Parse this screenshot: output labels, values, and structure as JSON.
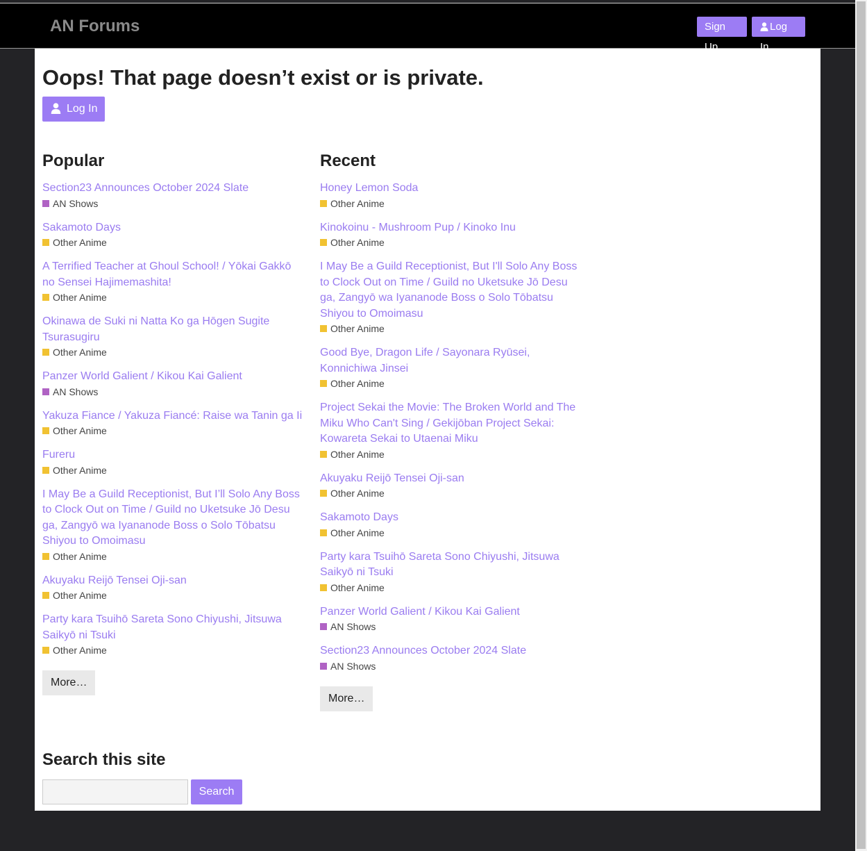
{
  "header": {
    "site_title": "AN Forums",
    "signup_label": "Sign Up",
    "login_label": "Log In"
  },
  "main": {
    "title": "Oops! That page doesn’t exist or is private.",
    "login_label": "Log In"
  },
  "colors": {
    "accent": "#9c7cf4",
    "link": "#9a7cf0",
    "category_an_shows": "#b063c4",
    "category_other_anime": "#f1c232"
  },
  "popular": {
    "heading": "Popular",
    "more_label": "More…",
    "topics": [
      {
        "title": "Section23 Announces October 2024 Slate",
        "category": "AN Shows",
        "color": "#b063c4"
      },
      {
        "title": "Sakamoto Days",
        "category": "Other Anime",
        "color": "#f1c232"
      },
      {
        "title": "A Terrified Teacher at Ghoul School! / Yōkai Gakkō no Sensei Hajimemashita!",
        "category": "Other Anime",
        "color": "#f1c232"
      },
      {
        "title": "Okinawa de Suki ni Natta Ko ga Hōgen Sugite Tsurasugiru",
        "category": "Other Anime",
        "color": "#f1c232"
      },
      {
        "title": "Panzer World Galient / Kikou Kai Galient",
        "category": "AN Shows",
        "color": "#b063c4"
      },
      {
        "title": "Yakuza Fiance / Yakuza Fiancé: Raise wa Tanin ga Ii",
        "category": "Other Anime",
        "color": "#f1c232"
      },
      {
        "title": "Fureru",
        "category": "Other Anime",
        "color": "#f1c232"
      },
      {
        "title": "I May Be a Guild Receptionist, But I’ll Solo Any Boss to Clock Out on Time / Guild no Uketsuke Jō Desu ga, Zangyō wa Iyananode Boss o Solo Tōbatsu Shiyou to Omoimasu",
        "category": "Other Anime",
        "color": "#f1c232"
      },
      {
        "title": "Akuyaku Reijō Tensei Oji-san",
        "category": "Other Anime",
        "color": "#f1c232"
      },
      {
        "title": "Party kara Tsuihō Sareta Sono Chiyushi, Jitsuwa Saikyō ni Tsuki",
        "category": "Other Anime",
        "color": "#f1c232"
      }
    ]
  },
  "recent": {
    "heading": "Recent",
    "more_label": "More…",
    "topics": [
      {
        "title": "Honey Lemon Soda",
        "category": "Other Anime",
        "color": "#f1c232"
      },
      {
        "title": "Kinokoinu - Mushroom Pup / Kinoko Inu",
        "category": "Other Anime",
        "color": "#f1c232"
      },
      {
        "title": "I May Be a Guild Receptionist, But I'll Solo Any Boss to Clock Out on Time / Guild no Uketsuke Jō Desu ga, Zangyō wa Iyananode Boss o Solo Tōbatsu Shiyou to Omoimasu",
        "category": "Other Anime",
        "color": "#f1c232"
      },
      {
        "title": "Good Bye, Dragon Life / Sayonara Ryūsei, Konnichiwa Jinsei",
        "category": "Other Anime",
        "color": "#f1c232"
      },
      {
        "title": "Project Sekai the Movie: The Broken World and The Miku Who Can't Sing / Gekijōban Project Sekai: Kowareta Sekai to Utaenai Miku",
        "category": "Other Anime",
        "color": "#f1c232"
      },
      {
        "title": "Akuyaku Reijō Tensei Oji-san",
        "category": "Other Anime",
        "color": "#f1c232"
      },
      {
        "title": "Sakamoto Days",
        "category": "Other Anime",
        "color": "#f1c232"
      },
      {
        "title": "Party kara Tsuihō Sareta Sono Chiyushi, Jitsuwa Saikyō ni Tsuki",
        "category": "Other Anime",
        "color": "#f1c232"
      },
      {
        "title": "Panzer World Galient / Kikou Kai Galient",
        "category": "AN Shows",
        "color": "#b063c4"
      },
      {
        "title": "Section23 Announces October 2024 Slate",
        "category": "AN Shows",
        "color": "#b063c4"
      }
    ]
  },
  "search": {
    "heading": "Search this site",
    "placeholder": "",
    "button_label": "Search"
  }
}
